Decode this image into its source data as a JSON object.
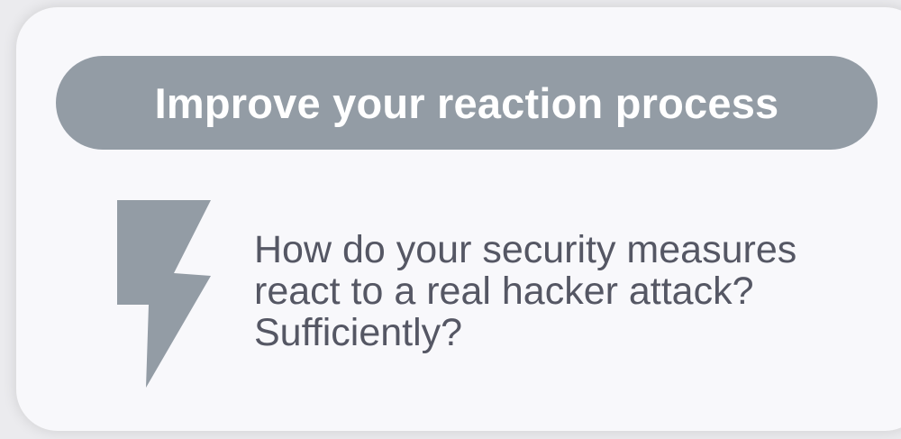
{
  "card": {
    "title": "Improve your reaction process",
    "description": "How do your security measures react to a real hacker attack? Sufficiently?",
    "icon": "lightning-bolt-icon"
  },
  "colors": {
    "accent": "#939ca5",
    "text": "#555764",
    "card_background": "#f8f8fb",
    "page_background": "#ebebee"
  }
}
